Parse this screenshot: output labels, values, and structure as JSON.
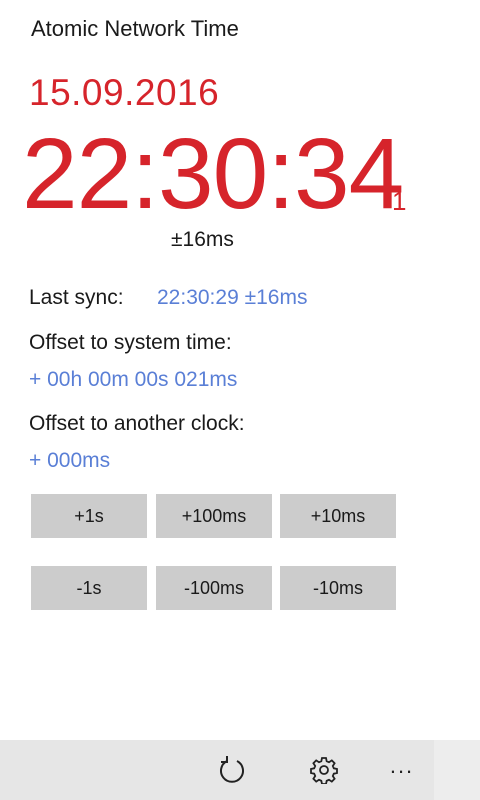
{
  "app": {
    "title": "Atomic Network Time"
  },
  "clock": {
    "date": "15.09.2016",
    "time": "22:30:34",
    "tenths": "1",
    "accuracy": "±16ms",
    "color": "#d6242b"
  },
  "sync": {
    "last_sync_label": "Last sync:",
    "last_sync_value": "22:30:29 ±16ms",
    "offset_system_label": "Offset to system time:",
    "offset_system_value": "+ 00h 00m 00s 021ms",
    "offset_clock_label": "Offset to another clock:",
    "offset_clock_value": "+ 000ms",
    "value_color": "#5a7fd6"
  },
  "adjust_buttons": {
    "plus_1s": "+1s",
    "plus_100ms": "+100ms",
    "plus_10ms": "+10ms",
    "minus_1s": "-1s",
    "minus_100ms": "-100ms",
    "minus_10ms": "-10ms"
  },
  "appbar": {
    "refresh_icon": "refresh-icon",
    "settings_icon": "gear-icon",
    "more_label": "..."
  }
}
